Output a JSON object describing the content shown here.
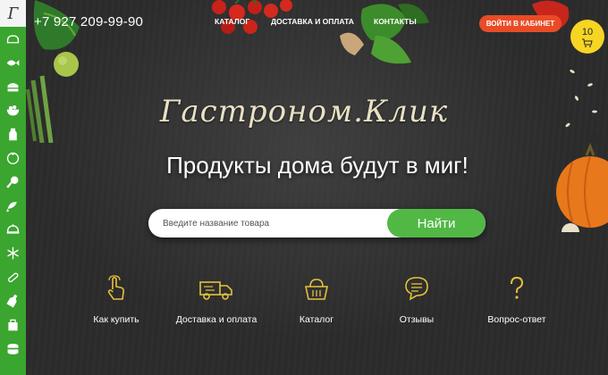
{
  "header": {
    "phone": "+7 927 209-99-90",
    "nav": [
      "КАТАЛОГ",
      "ДОСТАВКА И ОПЛАТА",
      "КОНТАКТЫ"
    ],
    "login_label": "ВОЙТИ В КАБИНЕТ",
    "cart_count": "10"
  },
  "sidebar": {
    "logo_letter": "Г",
    "categories": [
      "bread-icon",
      "fish-icon",
      "cake-icon",
      "salad-icon",
      "milk-icon",
      "tomato-icon",
      "chicken-leg-icon",
      "fish-icon",
      "cloche-icon",
      "snowflake-icon",
      "sausage-icon",
      "bottle-icon",
      "bag-icon",
      "canned-food-icon"
    ]
  },
  "hero": {
    "brand": "Гастроном.Клик",
    "headline": "Продукты дома будут в миг!"
  },
  "search": {
    "placeholder": "Введите название товара",
    "button_label": "Найти"
  },
  "features": [
    {
      "label": "Как купить",
      "icon": "hand-click-icon"
    },
    {
      "label": "Доставка и оплата",
      "icon": "truck-icon"
    },
    {
      "label": "Каталог",
      "icon": "basket-icon"
    },
    {
      "label": "Отзывы",
      "icon": "chat-icon"
    },
    {
      "label": "Вопрос-ответ",
      "icon": "question-icon"
    }
  ],
  "colors": {
    "sidebar_green": "#3aa52f",
    "accent_yellow": "#e5c13a",
    "button_green": "#51b845",
    "login_red": "#e94b27",
    "cart_yellow": "#f6d523"
  }
}
